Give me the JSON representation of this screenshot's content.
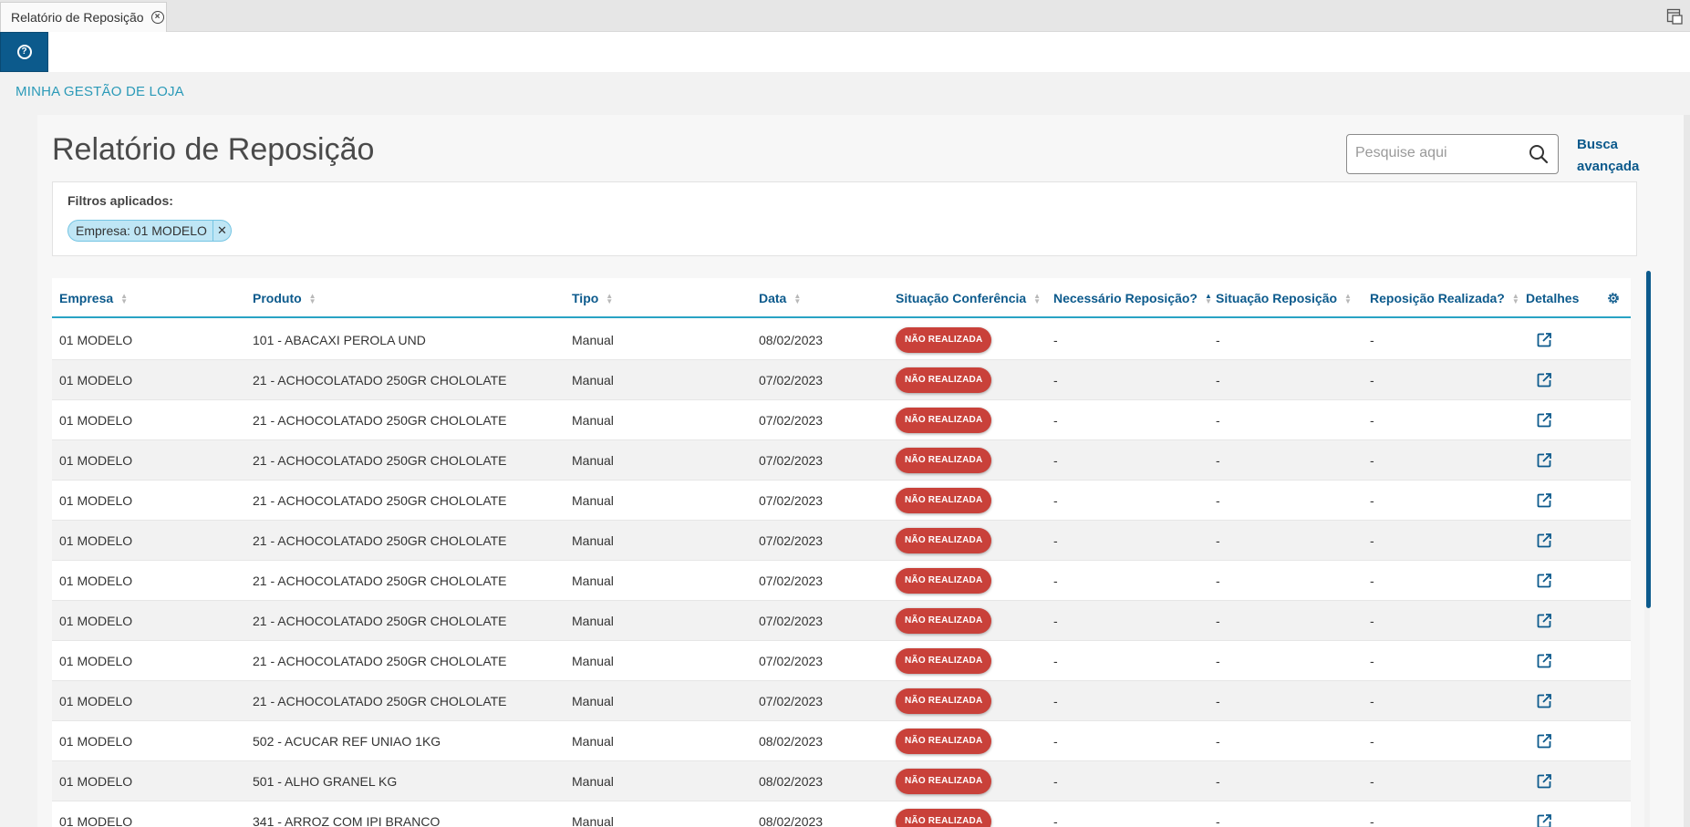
{
  "tab": {
    "title": "Relatório de Reposição"
  },
  "breadcrumb": "MINHA GESTÃO DE LOJA",
  "page": {
    "title": "Relatório de Reposição"
  },
  "search": {
    "placeholder": "Pesquise aqui",
    "advanced_line1": "Busca",
    "advanced_line2": "avançada"
  },
  "filters": {
    "label": "Filtros aplicados:",
    "chips": [
      "Empresa: 01 MODELO"
    ]
  },
  "table": {
    "columns": [
      "Empresa",
      "Produto",
      "Tipo",
      "Data",
      "Situação Conferência",
      "Necessário Reposição?",
      "Situação Reposição",
      "Reposição Realizada?",
      "Detalhes"
    ],
    "rows": [
      {
        "empresa": "01 MODELO",
        "produto": "101 - ABACAXI PEROLA UND",
        "tipo": "Manual",
        "data": "08/02/2023",
        "situacao": "NÃO REALIZADA",
        "necessario": "-",
        "sit_reposicao": "-",
        "realizada": "-"
      },
      {
        "empresa": "01 MODELO",
        "produto": "21 - ACHOCOLATADO 250GR CHOLOLATE",
        "tipo": "Manual",
        "data": "07/02/2023",
        "situacao": "NÃO REALIZADA",
        "necessario": "-",
        "sit_reposicao": "-",
        "realizada": "-"
      },
      {
        "empresa": "01 MODELO",
        "produto": "21 - ACHOCOLATADO 250GR CHOLOLATE",
        "tipo": "Manual",
        "data": "07/02/2023",
        "situacao": "NÃO REALIZADA",
        "necessario": "-",
        "sit_reposicao": "-",
        "realizada": "-"
      },
      {
        "empresa": "01 MODELO",
        "produto": "21 - ACHOCOLATADO 250GR CHOLOLATE",
        "tipo": "Manual",
        "data": "07/02/2023",
        "situacao": "NÃO REALIZADA",
        "necessario": "-",
        "sit_reposicao": "-",
        "realizada": "-"
      },
      {
        "empresa": "01 MODELO",
        "produto": "21 - ACHOCOLATADO 250GR CHOLOLATE",
        "tipo": "Manual",
        "data": "07/02/2023",
        "situacao": "NÃO REALIZADA",
        "necessario": "-",
        "sit_reposicao": "-",
        "realizada": "-"
      },
      {
        "empresa": "01 MODELO",
        "produto": "21 - ACHOCOLATADO 250GR CHOLOLATE",
        "tipo": "Manual",
        "data": "07/02/2023",
        "situacao": "NÃO REALIZADA",
        "necessario": "-",
        "sit_reposicao": "-",
        "realizada": "-"
      },
      {
        "empresa": "01 MODELO",
        "produto": "21 - ACHOCOLATADO 250GR CHOLOLATE",
        "tipo": "Manual",
        "data": "07/02/2023",
        "situacao": "NÃO REALIZADA",
        "necessario": "-",
        "sit_reposicao": "-",
        "realizada": "-"
      },
      {
        "empresa": "01 MODELO",
        "produto": "21 - ACHOCOLATADO 250GR CHOLOLATE",
        "tipo": "Manual",
        "data": "07/02/2023",
        "situacao": "NÃO REALIZADA",
        "necessario": "-",
        "sit_reposicao": "-",
        "realizada": "-"
      },
      {
        "empresa": "01 MODELO",
        "produto": "21 - ACHOCOLATADO 250GR CHOLOLATE",
        "tipo": "Manual",
        "data": "07/02/2023",
        "situacao": "NÃO REALIZADA",
        "necessario": "-",
        "sit_reposicao": "-",
        "realizada": "-"
      },
      {
        "empresa": "01 MODELO",
        "produto": "21 - ACHOCOLATADO 250GR CHOLOLATE",
        "tipo": "Manual",
        "data": "07/02/2023",
        "situacao": "NÃO REALIZADA",
        "necessario": "-",
        "sit_reposicao": "-",
        "realizada": "-"
      },
      {
        "empresa": "01 MODELO",
        "produto": "502 - ACUCAR REF UNIAO 1KG",
        "tipo": "Manual",
        "data": "08/02/2023",
        "situacao": "NÃO REALIZADA",
        "necessario": "-",
        "sit_reposicao": "-",
        "realizada": "-"
      },
      {
        "empresa": "01 MODELO",
        "produto": "501 - ALHO GRANEL KG",
        "tipo": "Manual",
        "data": "08/02/2023",
        "situacao": "NÃO REALIZADA",
        "necessario": "-",
        "sit_reposicao": "-",
        "realizada": "-"
      },
      {
        "empresa": "01 MODELO",
        "produto": "341 - ARROZ COM IPI BRANCO",
        "tipo": "Manual",
        "data": "08/02/2023",
        "situacao": "NÃO REALIZADA",
        "necessario": "-",
        "sit_reposicao": "-",
        "realizada": "-"
      }
    ]
  },
  "colors": {
    "primary": "#0c5a8c",
    "accent": "#29a3c4",
    "badge": "#c9413a",
    "chip": "#bfe6f5"
  },
  "icons": {
    "help": "help-circle-icon",
    "close_tab": "close-circle-icon",
    "search": "search-icon",
    "settings": "gear-icon",
    "details": "external-link-icon",
    "corner": "window-icon"
  }
}
